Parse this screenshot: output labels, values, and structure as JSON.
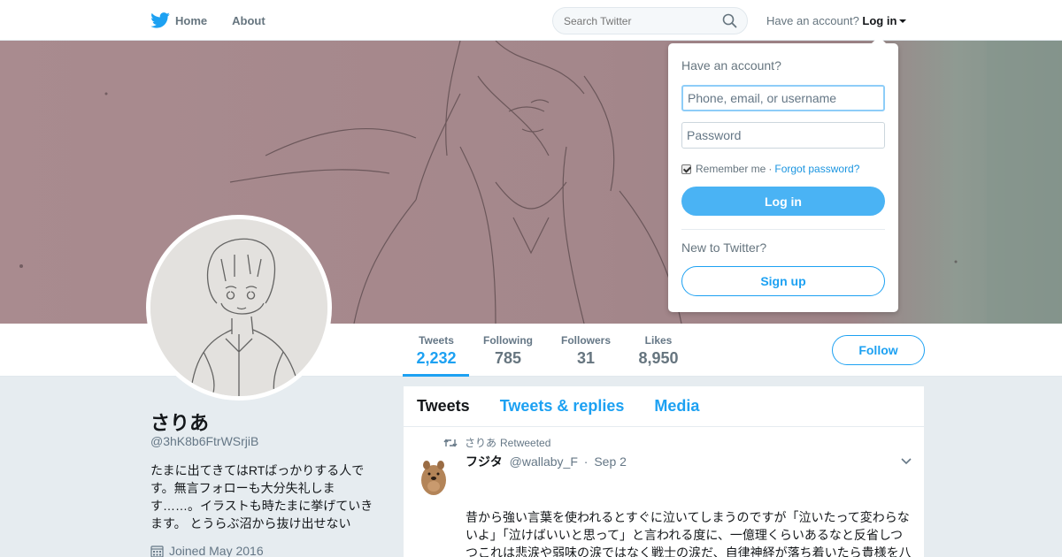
{
  "nav": {
    "home_label": "Home",
    "about_label": "About",
    "search_placeholder": "Search Twitter",
    "have_account": "Have an account?",
    "login_label": "Log in"
  },
  "profile": {
    "name": "さりあ",
    "handle": "@3hK8b6FtrWSrjiB",
    "bio": "たまに出てきてはRTばっかりする人です。無言フォローも大分失礼します……。イラストも時たまに挙げていきます。 とうらぶ沼から抜け出せない",
    "joined": "Joined May 2016",
    "follow_label": "Follow",
    "stats": [
      {
        "label": "Tweets",
        "value": "2,232"
      },
      {
        "label": "Following",
        "value": "785"
      },
      {
        "label": "Followers",
        "value": "31"
      },
      {
        "label": "Likes",
        "value": "8,950"
      }
    ]
  },
  "timeline": {
    "tabs": [
      "Tweets",
      "Tweets & replies",
      "Media"
    ],
    "tweet": {
      "retweeter": "さりあ",
      "retweeted_label": "Retweeted",
      "author_name": "フジタ",
      "author_handle": "@wallaby_F",
      "date": "Sep 2",
      "text": "昔から強い言葉を使われるとすぐに泣いてしまうのですが「泣いたって変わらないよ」「泣けばいいと思って」と言われる度に、一億理くらいあるなと反省しつつこれは悲涙や弱味の涙ではなく戦士の涙だ、自律神経が落ち着いたら貴様を八つ裂きにしてやる、泣く暇も与えない。って思ってるからな。"
    }
  },
  "login_dropdown": {
    "title": "Have an account?",
    "username_placeholder": "Phone, email, or username",
    "password_placeholder": "Password",
    "remember_label": "Remember me",
    "separator": "·",
    "forgot_label": "Forgot password?",
    "login_button": "Log in",
    "new_label": "New to Twitter?",
    "signup_button": "Sign up"
  },
  "colors": {
    "accent": "#1da1f2",
    "login_button_bg": "#4ab3f4",
    "page_bg": "#e6ecf0"
  }
}
